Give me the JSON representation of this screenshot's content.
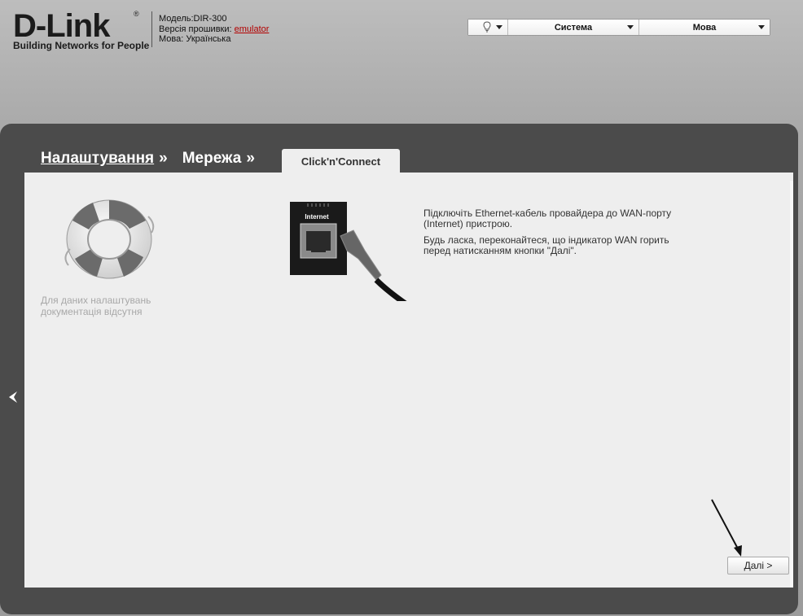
{
  "header": {
    "brand": "D-Link",
    "reg_mark": "®",
    "tagline": "Building Networks for People",
    "model_label": "Модель:",
    "model_value": "DIR-300",
    "firmware_label": "Версія прошивки:",
    "firmware_value": "emulator",
    "language_label": "Мова:",
    "language_value": "Українська"
  },
  "topmenu": {
    "system_label": "Система",
    "language_label": "Мова"
  },
  "breadcrumb": {
    "item1": "Налаштування",
    "sep1": "»",
    "item2": "Мережа",
    "sep2": "»"
  },
  "tab": {
    "label": "Click'n'Connect"
  },
  "help": {
    "no_docs_line1": "Для даних налаштувань",
    "no_docs_line2": "документація відсутня"
  },
  "port_icon": {
    "label": "Internet"
  },
  "instructions": {
    "line1": "Підключіть Ethernet-кабель провайдера до WAN-порту (Internet) пристрою.",
    "line2": "Будь ласка, переконайтеся, що індикатор WAN горить перед натисканням кнопки \"Далі\"."
  },
  "buttons": {
    "next": "Далі >"
  },
  "colors": {
    "panel": "#4b4b4b",
    "content": "#eeeeee",
    "firmware_link": "#b30000"
  }
}
